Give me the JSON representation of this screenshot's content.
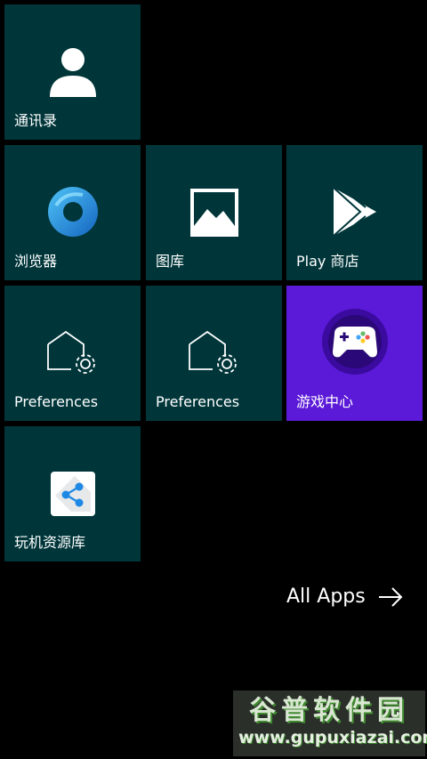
{
  "tiles": [
    {
      "label": "通讯录",
      "icon": "contact-person-icon"
    },
    {
      "label": "浏览器",
      "icon": "browser-ring-icon"
    },
    {
      "label": "图库",
      "icon": "gallery-mountain-icon"
    },
    {
      "label": "Play 商店",
      "icon": "play-store-triangle-icon"
    },
    {
      "label": "Preferences",
      "icon": "preferences-house-gear-icon"
    },
    {
      "label": "Preferences",
      "icon": "preferences-house-gear-icon"
    },
    {
      "label": "游戏中心",
      "icon": "gamepad-icon"
    },
    {
      "label": "玩机资源库",
      "icon": "share-toolbox-icon"
    }
  ],
  "all_apps": {
    "label": "All Apps"
  },
  "watermark": {
    "line1": "谷普软件园",
    "line2": "www.gupuxiazai.com"
  },
  "colors": {
    "tile": "#00363a",
    "games_tile": "#5b1ad8",
    "background": "#000000",
    "browser_blue": "#1e88e5"
  }
}
